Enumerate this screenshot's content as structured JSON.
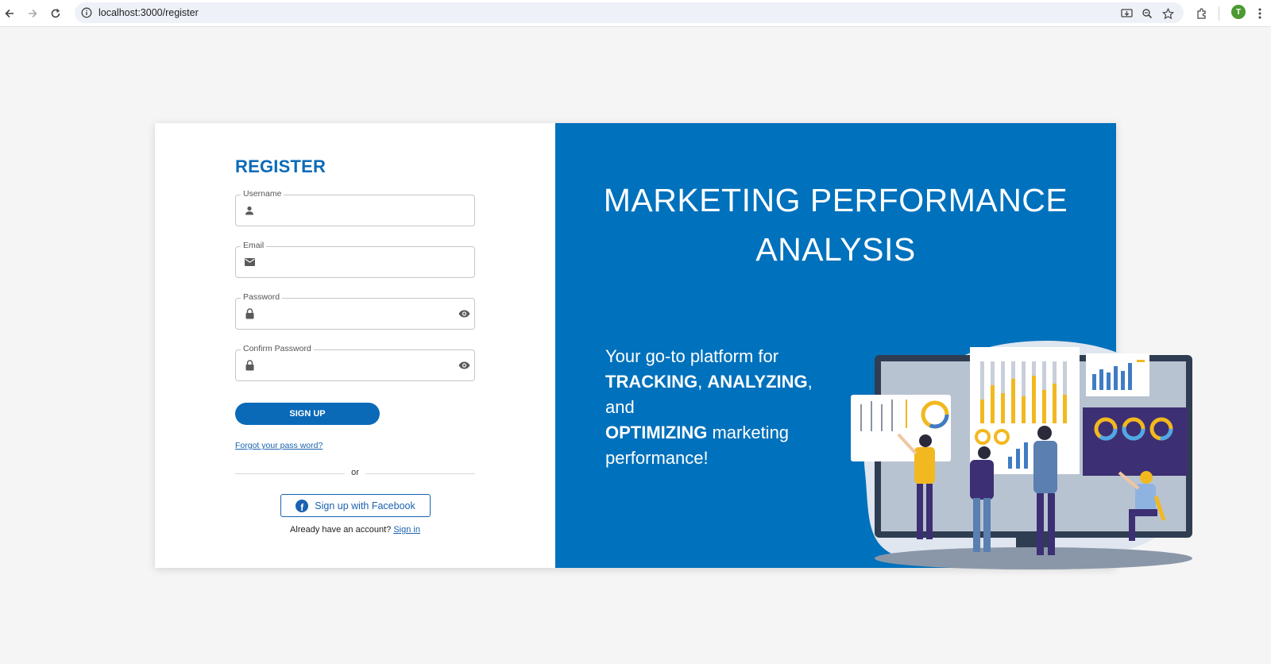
{
  "browser": {
    "url": "localhost:3000/register",
    "profile_initial": "T",
    "icons": [
      "back-icon",
      "forward-icon",
      "reload-icon",
      "info-icon",
      "install-icon",
      "zoom-icon",
      "star-icon",
      "extensions-icon",
      "menu-icon"
    ]
  },
  "register": {
    "title": "REGISTER",
    "fields": {
      "username": {
        "label": "Username",
        "value": ""
      },
      "email": {
        "label": "Email",
        "value": ""
      },
      "password": {
        "label": "Password",
        "value": ""
      },
      "confirm": {
        "label": "Confirm Password",
        "value": ""
      }
    },
    "signup_label": "SIGN UP",
    "forgot_label": "Forgot your pass word?",
    "or_label": "or",
    "facebook_label": "Sign up with Facebook",
    "account_text": "Already have an account?",
    "signin_label": "Sign in"
  },
  "hero": {
    "title_line1": "MARKETING PERFORMANCE",
    "title_line2": "ANALYSIS",
    "tag_1": "Your go-to platform for",
    "tag_tracking": "TRACKING",
    "tag_comma1": ", ",
    "tag_analyzing": "ANALYZING",
    "tag_and": ", and",
    "tag_optimizing": "OPTIMIZING",
    "tag_marketing": " marketing",
    "tag_end": "performance!"
  },
  "colors": {
    "primary": "#0a6ab8",
    "panel": "#0071bc",
    "accent_yellow": "#f2b81f",
    "dark_purple": "#3d2f73"
  }
}
